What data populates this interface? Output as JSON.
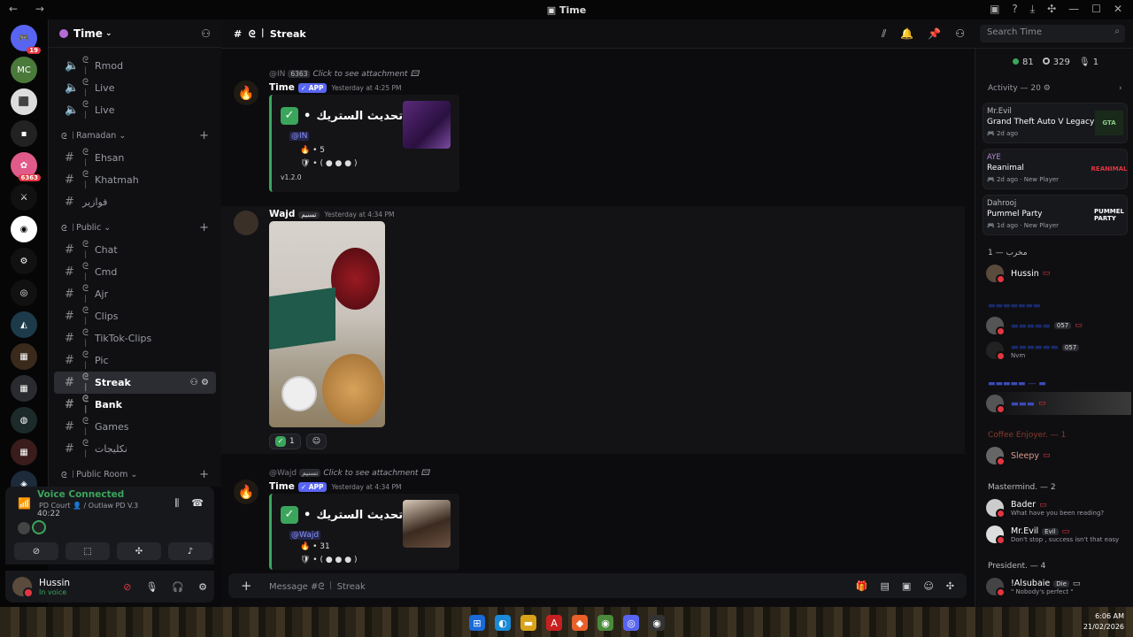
{
  "window": {
    "title": "Time"
  },
  "servers": {
    "badge_count": "19",
    "item_badge": "6363"
  },
  "guild": {
    "name": "Time"
  },
  "channels": [
    {
      "label": "Rmod",
      "type": "voice"
    },
    {
      "label": "Live",
      "type": "voice"
    },
    {
      "label": "Live",
      "type": "voice"
    },
    {
      "category": "Ramadan"
    },
    {
      "label": "Ehsan",
      "type": "text"
    },
    {
      "label": "Khatmah",
      "type": "text"
    },
    {
      "label": "فوازير",
      "type": "text"
    },
    {
      "category": "Public"
    },
    {
      "label": "Chat",
      "type": "text"
    },
    {
      "label": "Cmd",
      "type": "text"
    },
    {
      "label": "Ajr",
      "type": "text"
    },
    {
      "label": "Clips",
      "type": "text"
    },
    {
      "label": "TikTok-Clips",
      "type": "text"
    },
    {
      "label": "Pic",
      "type": "text"
    },
    {
      "label": "Streak",
      "type": "text",
      "active": true
    },
    {
      "label": "Bank",
      "type": "text",
      "unread": true
    },
    {
      "label": "Games",
      "type": "text"
    },
    {
      "label": "نكليجات",
      "type": "text"
    },
    {
      "category": "Public Room"
    }
  ],
  "voice": {
    "status": "Voice Connected",
    "location": "PD Court 👤 / Outlaw PD V.3",
    "time": "40:22"
  },
  "user": {
    "name": "Hussin",
    "status": "In voice"
  },
  "channel_header": {
    "name": "Streak"
  },
  "search": {
    "placeholder": "Search Time"
  },
  "messages": [
    {
      "reply_user": "@IN",
      "reply_tag": "6363",
      "reply_text": "Click to see attachment",
      "author": "Time",
      "tag": "✓ APP",
      "time": "Yesterday at 4:25 PM",
      "embed_title": "تم تحديث الستريك",
      "mention": "@IN",
      "streak": "5",
      "version": "v1.2.0"
    },
    {
      "author": "Wajd",
      "tag": "تسنيم",
      "time": "Yesterday at 4:34 PM",
      "reaction_count": "1"
    },
    {
      "reply_user": "@Wajd",
      "reply_tag": "تسنيم",
      "reply_text": "Click to see attachment",
      "author": "Time",
      "tag": "✓ APP",
      "time": "Yesterday at 4:34 PM",
      "embed_title": "تم تحديث الستريك",
      "mention": "@Wajd",
      "streak": "31"
    }
  ],
  "composer": {
    "placeholder": "Message #ᘓ ꒐ Streak"
  },
  "members": {
    "stats": {
      "online": "81",
      "idle": "329",
      "voice": "1"
    },
    "activity_header": "Activity — 20",
    "activities": [
      {
        "user": "Mr.Evil",
        "game": "Grand Theft Auto V Legacy",
        "meta": "2d ago",
        "logo": "GTA"
      },
      {
        "user": "AYE",
        "game": "Reanimal",
        "meta": "2d ago · New Player",
        "logo": "REANIMAL"
      },
      {
        "user": "Dahrooj",
        "game": "Pummel Party",
        "meta": "1d ago · New Player",
        "logo": "PUMMEL PARTY"
      }
    ],
    "roles": [
      {
        "name": "مخرب — 1",
        "members": [
          {
            "name": "Hussin"
          }
        ]
      },
      {
        "name": "Coffee Enjoyer. — 1",
        "members": [
          {
            "name": "Sleepy"
          }
        ]
      },
      {
        "name": "Mastermind. — 2",
        "members": [
          {
            "name": "Bader",
            "status": "What have you been reading?"
          },
          {
            "name": "Mr.Evil",
            "tag": "Evil",
            "status": "Don't stop , success isn't that easy"
          }
        ]
      },
      {
        "name": "President. — 4",
        "members": [
          {
            "name": "!Alsubaie",
            "tag": "Die",
            "status": "\" Nobody's perfect \""
          }
        ]
      }
    ],
    "extra_tags": [
      "057",
      "057"
    ],
    "extra_status": "Nvm"
  },
  "taskbar": {
    "time": "6:06 AM",
    "date": "21/02/2026"
  }
}
